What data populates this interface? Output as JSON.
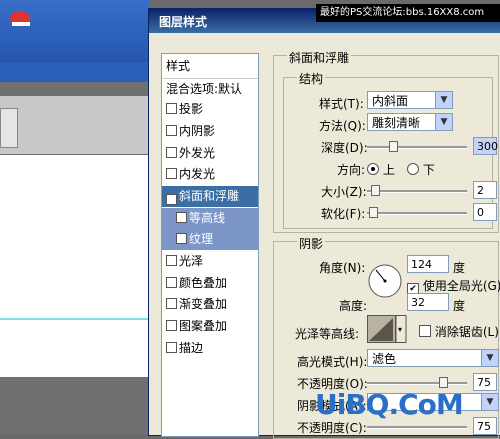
{
  "watermark": "最好的PS交流论坛:bbs.16XX8.com",
  "dialog": {
    "title": "图层样式"
  },
  "styles_panel": {
    "header": "样式",
    "blend": "混合选项:默认",
    "items": [
      {
        "label": "投影",
        "checked": false
      },
      {
        "label": "内阴影",
        "checked": false
      },
      {
        "label": "外发光",
        "checked": false
      },
      {
        "label": "内发光",
        "checked": false
      },
      {
        "label": "斜面和浮雕",
        "checked": true
      },
      {
        "label": "等高线",
        "checked": false
      },
      {
        "label": "纹理",
        "checked": false
      },
      {
        "label": "光泽",
        "checked": false
      },
      {
        "label": "颜色叠加",
        "checked": false
      },
      {
        "label": "渐变叠加",
        "checked": false
      },
      {
        "label": "图案叠加",
        "checked": false
      },
      {
        "label": "描边",
        "checked": false
      }
    ]
  },
  "bevel": {
    "title": "斜面和浮雕",
    "structure": "结构",
    "style_label": "样式(T):",
    "style_value": "内斜面",
    "method_label": "方法(Q):",
    "method_value": "雕刻清晰",
    "depth_label": "深度(D):",
    "depth_value": "300",
    "direction_label": "方向:",
    "up": "上",
    "down": "下",
    "size_label": "大小(Z):",
    "size_value": "2",
    "soften_label": "软化(F):",
    "soften_value": "0"
  },
  "shading": {
    "title": "阴影",
    "angle_label": "角度(N):",
    "angle_value": "124",
    "degree": "度",
    "global_light": "使用全局光(G)",
    "altitude_label": "高度:",
    "altitude_value": "32",
    "gloss_label": "光泽等高线:",
    "antialias": "消除锯齿(L)",
    "highlight_label": "高光模式(H):",
    "highlight_value": "滤色",
    "opacity_label": "不透明度(O):",
    "opacity_value": "75",
    "shadow_label": "阴影模式(A):",
    "opacity2_label": "不透明度(C):",
    "opacity2_value": "75"
  },
  "site_watermark": "UiBQ.CoM"
}
